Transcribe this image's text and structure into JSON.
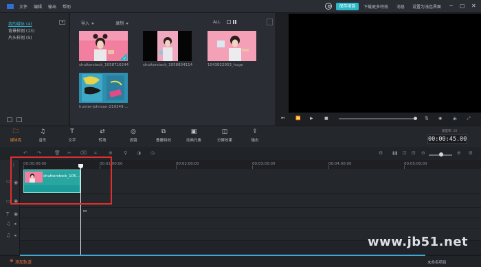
{
  "menubar": {
    "items": [
      "文件",
      "编辑",
      "输出",
      "帮助"
    ],
    "save_project": "保存项目",
    "download_effects": "下载更多特效",
    "messages": "消息",
    "simple_mode": "设置为浅色界面"
  },
  "library": {
    "categories": [
      {
        "label": "我的媒体 (4)",
        "active": true
      },
      {
        "label": "背景样例 (13)",
        "active": false
      },
      {
        "label": "片头样例 (9)",
        "active": false
      }
    ],
    "import_label": "导入",
    "record_label": "录制",
    "filter_label": "ALL"
  },
  "media": [
    {
      "name": "shutterstock_1058716244",
      "checked": true
    },
    {
      "name": "shutterstock_1058804114",
      "checked": false
    },
    {
      "name": "1043822953_huge",
      "checked": false
    },
    {
      "name": "hunter-johnson-219349-...",
      "checked": false
    }
  ],
  "toolbar": {
    "tools": [
      {
        "icon": "folder-icon",
        "label": "媒体库",
        "active": true
      },
      {
        "icon": "music-icon",
        "label": "音乐",
        "active": false
      },
      {
        "icon": "text-icon",
        "label": "文字",
        "active": false
      },
      {
        "icon": "transition-icon",
        "label": "转场",
        "active": false
      },
      {
        "icon": "filter-icon",
        "label": "滤镜",
        "active": false
      },
      {
        "icon": "overlay-icon",
        "label": "叠覆特效",
        "active": false
      },
      {
        "icon": "animated-elements-icon",
        "label": "动画元素",
        "active": false
      },
      {
        "icon": "split-screen-icon",
        "label": "分屏效果",
        "active": false
      },
      {
        "icon": "export-icon",
        "label": "输出",
        "active": false
      }
    ],
    "timecode_label": "速度率: 1X",
    "timecode": "00:00:45.00"
  },
  "timeline": {
    "ruler": [
      "00:00:00:00",
      "00:01:00:00",
      "00:02:00:00",
      "00:03:00:00",
      "00:04:00:00",
      "00:05:00:00"
    ],
    "clip_name": "shutterstock_105..."
  },
  "bottom": {
    "add_track": "添加轨道",
    "project_name": "未命名项目",
    "watermark": "www.jb51.net"
  }
}
